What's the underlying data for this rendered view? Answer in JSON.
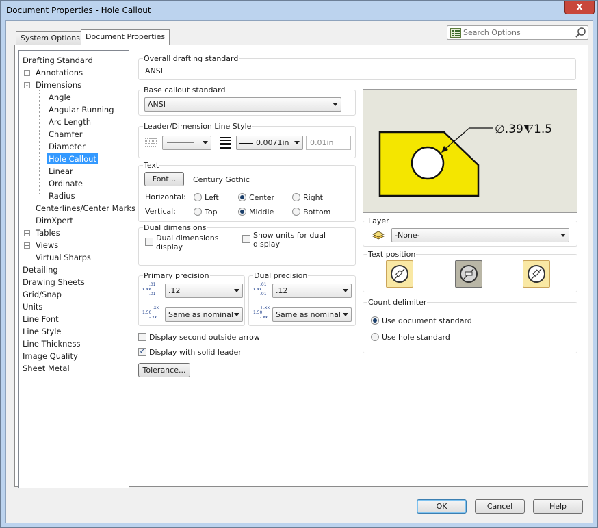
{
  "window": {
    "title": "Document Properties - Hole Callout",
    "close": "x"
  },
  "tabs": [
    {
      "label": "System Options"
    },
    {
      "label": "Document Properties"
    }
  ],
  "search": {
    "placeholder": "Search Options"
  },
  "tree": {
    "items": [
      {
        "label": "Drafting Standard"
      },
      {
        "label": "Annotations",
        "expander": "+"
      },
      {
        "label": "Dimensions",
        "expander": "-"
      },
      {
        "label": "Angle"
      },
      {
        "label": "Angular Running"
      },
      {
        "label": "Arc Length"
      },
      {
        "label": "Chamfer"
      },
      {
        "label": "Diameter"
      },
      {
        "label": "Hole Callout"
      },
      {
        "label": "Linear"
      },
      {
        "label": "Ordinate"
      },
      {
        "label": "Radius"
      },
      {
        "label": "Centerlines/Center Marks"
      },
      {
        "label": "DimXpert"
      },
      {
        "label": "Tables",
        "expander": "+"
      },
      {
        "label": "Views",
        "expander": "+"
      },
      {
        "label": "Virtual Sharps"
      },
      {
        "label": "Detailing"
      },
      {
        "label": "Drawing Sheets"
      },
      {
        "label": "Grid/Snap"
      },
      {
        "label": "Units"
      },
      {
        "label": "Line Font"
      },
      {
        "label": "Line Style"
      },
      {
        "label": "Line Thickness"
      },
      {
        "label": "Image Quality"
      },
      {
        "label": "Sheet Metal"
      }
    ]
  },
  "overall": {
    "label": "Overall drafting standard",
    "value": "ANSI"
  },
  "base_callout": {
    "label": "Base callout standard",
    "value": "ANSI"
  },
  "leader": {
    "label": "Leader/Dimension Line Style",
    "thickness": "0.0071in",
    "custom": "0.01in"
  },
  "text": {
    "label": "Text",
    "font_button": "Font...",
    "font_name": "Century Gothic",
    "horizontal_label": "Horizontal:",
    "vertical_label": "Vertical:",
    "h_options": [
      "Left",
      "Center",
      "Right"
    ],
    "v_options": [
      "Top",
      "Middle",
      "Bottom"
    ],
    "h_selected": "Center",
    "v_selected": "Middle"
  },
  "dual": {
    "label": "Dual dimensions",
    "dual_display": "Dual dimensions display",
    "show_units": "Show units for dual display"
  },
  "primary_precision": {
    "label": "Primary precision",
    "value": ".12",
    "tolerance": "Same as nominal"
  },
  "dual_precision": {
    "label": "Dual precision",
    "value": ".12",
    "tolerance": "Same as nominal"
  },
  "precision_icons": {
    "top": "x.xx",
    "sup": ".01",
    "sub": ".01",
    "val": "1.50",
    "tsup": "+.xx",
    "tsub": "-.xx"
  },
  "options": {
    "second_arrow": "Display second outside arrow",
    "solid_leader": "Display with solid leader",
    "solid_leader_checked": true
  },
  "tolerance_button": "Tolerance...",
  "preview": {
    "callout": "∅.39⧨1.5",
    "fill": "#f4e600"
  },
  "layer": {
    "label": "Layer",
    "value": "-None-"
  },
  "text_position": {
    "label": "Text position"
  },
  "count_delimiter": {
    "label": "Count delimiter",
    "options": [
      "Use document standard",
      "Use hole standard"
    ],
    "selected": "Use document standard"
  },
  "footer": {
    "ok": "OK",
    "cancel": "Cancel",
    "help": "Help"
  }
}
